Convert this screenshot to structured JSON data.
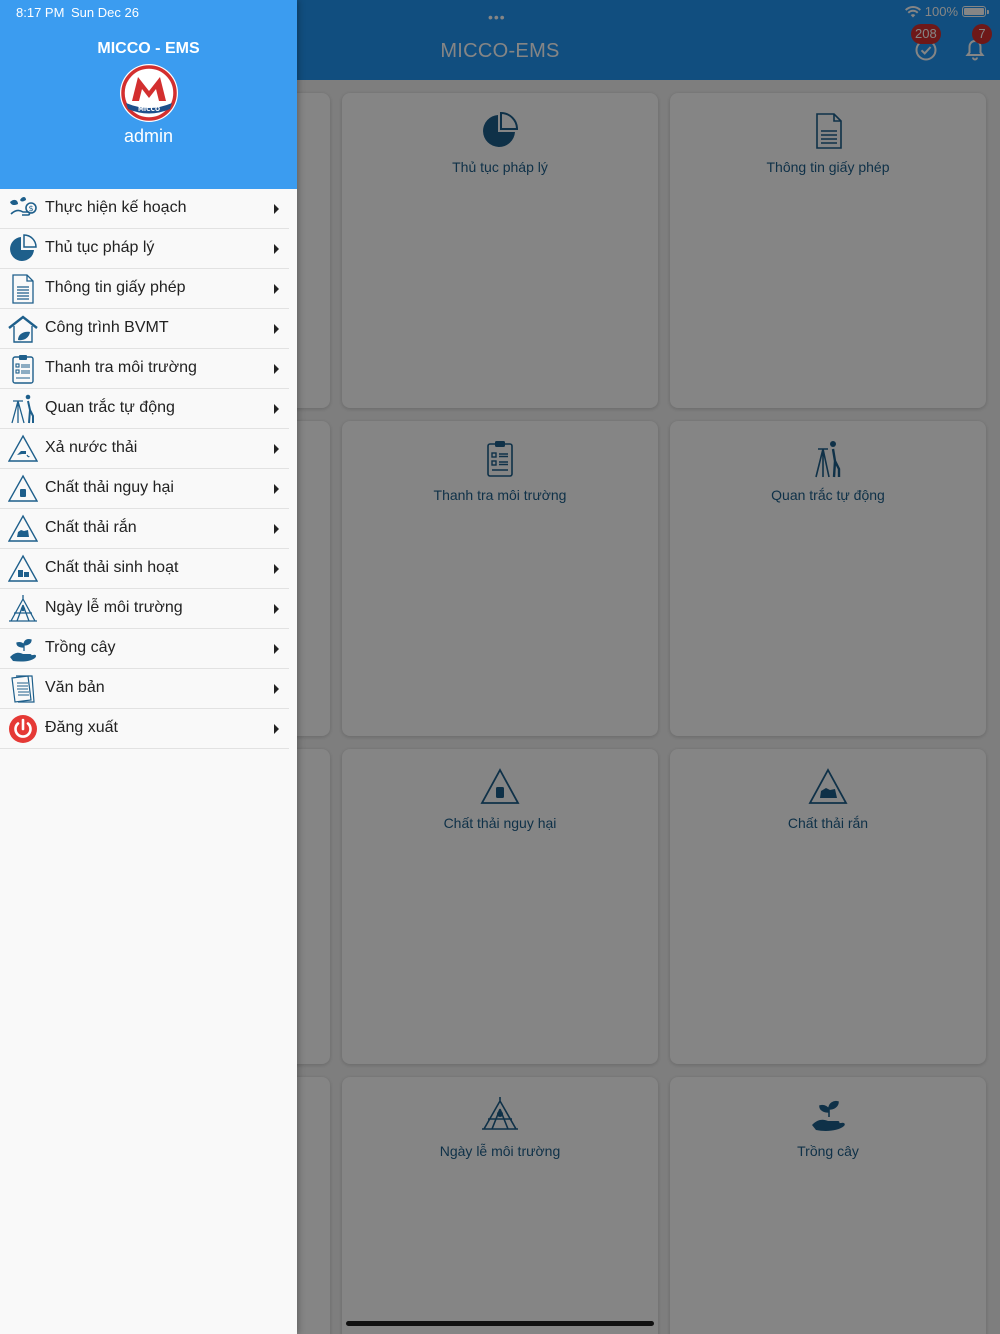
{
  "status": {
    "time": "8:17 PM",
    "date": "Sun Dec 26",
    "battery": "100%"
  },
  "appbar": {
    "title": "MICCO-EMS",
    "check_badge": "208",
    "bell_badge": "7",
    "multitask": "•••"
  },
  "cards": [
    {
      "label": "Thủ tục pháp lý",
      "icon": "pie-chart-icon"
    },
    {
      "label": "Thông tin giấy phép",
      "icon": "document-icon"
    },
    {
      "label": "Thanh tra môi trường",
      "icon": "clipboard-icon"
    },
    {
      "label": "Quan trắc tự động",
      "icon": "surveyor-icon"
    },
    {
      "label": "Chất thải nguy hại",
      "icon": "hazard-waste-icon"
    },
    {
      "label": "Chất thải rắn",
      "icon": "solid-waste-icon"
    },
    {
      "label": "Ngày lễ môi trường",
      "icon": "tent-icon"
    },
    {
      "label": "Trồng cây",
      "icon": "plant-hand-icon"
    }
  ],
  "drawer": {
    "app_name": "MICCO - EMS",
    "logo_text": "MICCO",
    "user": "admin",
    "items": [
      {
        "label": "Thực hiện kế hoạch",
        "icon": "plan-icon"
      },
      {
        "label": "Thủ tục pháp lý",
        "icon": "pie-chart-icon"
      },
      {
        "label": "Thông tin giấy phép",
        "icon": "document-icon"
      },
      {
        "label": "Công trình BVMT",
        "icon": "house-icon"
      },
      {
        "label": "Thanh tra môi trường",
        "icon": "clipboard-icon"
      },
      {
        "label": "Quan trắc tự động",
        "icon": "surveyor-icon"
      },
      {
        "label": "Xả nước thải",
        "icon": "wastewater-icon"
      },
      {
        "label": "Chất thải nguy hại",
        "icon": "hazard-waste-icon"
      },
      {
        "label": "Chất thải rắn",
        "icon": "solid-waste-icon"
      },
      {
        "label": "Chất thải sinh hoạt",
        "icon": "domestic-waste-icon"
      },
      {
        "label": "Ngày lễ môi trường",
        "icon": "tent-icon"
      },
      {
        "label": "Trồng cây",
        "icon": "plant-hand-icon"
      },
      {
        "label": "Văn bản",
        "icon": "papers-icon"
      },
      {
        "label": "Đăng xuất",
        "icon": "power-icon"
      }
    ]
  },
  "colors": {
    "primary": "#2196f3",
    "drawer_header": "#3b9cf0",
    "icon": "#1e5f8b",
    "logout": "#e53935"
  }
}
